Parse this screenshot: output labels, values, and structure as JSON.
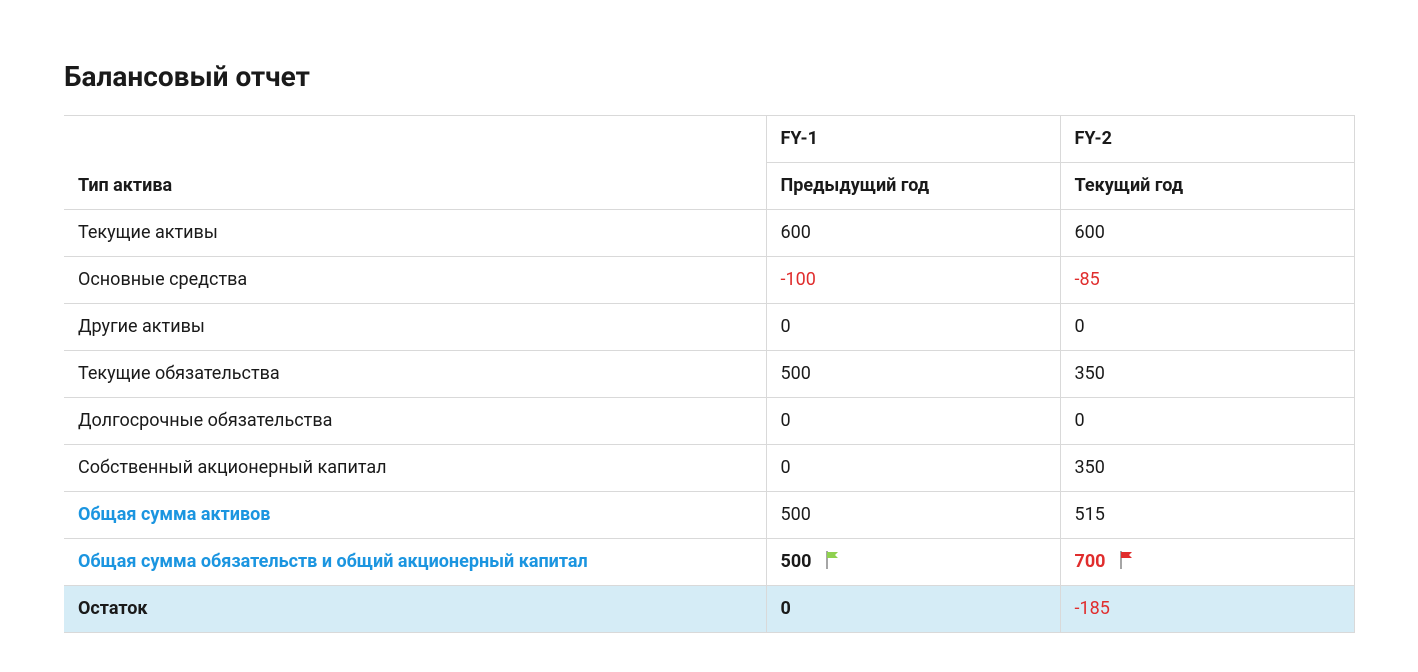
{
  "title": "Балансовый отчет",
  "columns": {
    "label_header": "Тип актива",
    "fy1_super": "FY-1",
    "fy2_super": "FY-2",
    "fy1_sub": "Предыдущий год",
    "fy2_sub": "Текущий год"
  },
  "rows": {
    "current_assets": {
      "label": "Текущие активы",
      "fy1": "600",
      "fy1_neg": false,
      "fy2": "600",
      "fy2_neg": false
    },
    "fixed_assets": {
      "label": "Основные средства",
      "fy1": "-100",
      "fy1_neg": true,
      "fy2": "-85",
      "fy2_neg": true
    },
    "other_assets": {
      "label": "Другие активы",
      "fy1": "0",
      "fy1_neg": false,
      "fy2": "0",
      "fy2_neg": false
    },
    "current_liab": {
      "label": "Текущие обязательства",
      "fy1": "500",
      "fy1_neg": false,
      "fy2": "350",
      "fy2_neg": false
    },
    "longterm_liab": {
      "label": "Долгосрочные обязательства",
      "fy1": "0",
      "fy1_neg": false,
      "fy2": "0",
      "fy2_neg": false
    },
    "equity": {
      "label": "Собственный акционерный капитал",
      "fy1": "0",
      "fy1_neg": false,
      "fy2": "350",
      "fy2_neg": false
    },
    "total_assets": {
      "label": "Общая сумма активов",
      "fy1": "500",
      "fy1_neg": false,
      "fy2": "515",
      "fy2_neg": false
    },
    "total_liab_equity": {
      "label": "Общая сумма обязательств и общий акционерный капитал",
      "fy1": "500",
      "fy1_neg": false,
      "fy1_flag": "green",
      "fy2": "700",
      "fy2_neg": true,
      "fy2_flag": "red"
    },
    "balance": {
      "label": "Остаток",
      "fy1": "0",
      "fy1_neg": false,
      "fy2": "-185",
      "fy2_neg": true
    }
  },
  "flag_colors": {
    "green": "#8fd14f",
    "red": "#e02d2d"
  }
}
